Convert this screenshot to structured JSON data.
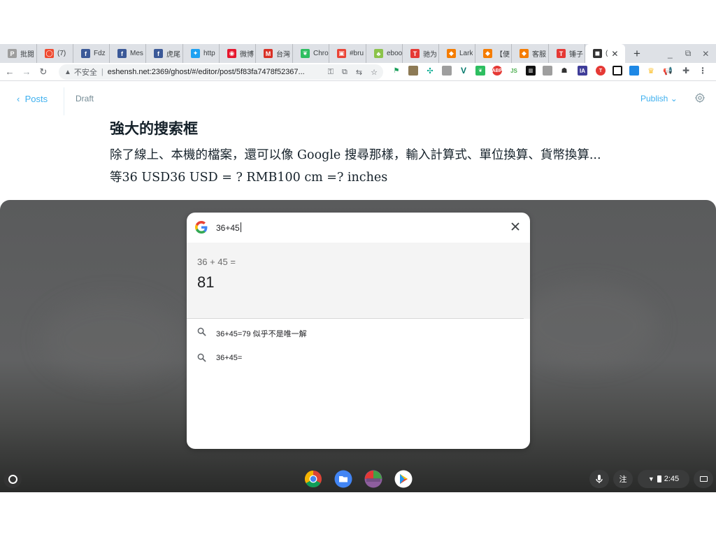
{
  "tabs": [
    {
      "title": "批閱",
      "color": "#9e9e9e",
      "glyph": "P"
    },
    {
      "title": "(7) ",
      "color": "#ef4a30",
      "glyph": "◯"
    },
    {
      "title": "Fdz",
      "color": "#3b5998",
      "glyph": "f"
    },
    {
      "title": "Mes",
      "color": "#3b5998",
      "glyph": "f"
    },
    {
      "title": "虎尾",
      "color": "#3b5998",
      "glyph": "f"
    },
    {
      "title": "http",
      "color": "#1da1f2",
      "glyph": "✦"
    },
    {
      "title": "微博",
      "color": "#e6162d",
      "glyph": "◉"
    },
    {
      "title": "台灣",
      "color": "#d93025",
      "glyph": "M"
    },
    {
      "title": "Chro",
      "color": "#2dbe60",
      "glyph": "❦"
    },
    {
      "title": "#bru",
      "color": "#ea4335",
      "glyph": "▣"
    },
    {
      "title": "eboo",
      "color": "#8bc34a",
      "glyph": "♣"
    },
    {
      "title": "驰为",
      "color": "#e53935",
      "glyph": "T"
    },
    {
      "title": "Lark",
      "color": "#f57c00",
      "glyph": "◆"
    },
    {
      "title": "【便",
      "color": "#f57c00",
      "glyph": "◆"
    },
    {
      "title": "客服",
      "color": "#f57c00",
      "glyph": "◆"
    },
    {
      "title": "锤子",
      "color": "#e53935",
      "glyph": "T"
    },
    {
      "title": "(",
      "color": "#333333",
      "glyph": "◼",
      "active": true
    }
  ],
  "new_tab_label": "+",
  "omnibox": {
    "warning_icon": "warning-triangle-icon",
    "insecure_label": "不安全",
    "url": "eshensh.net:2369/ghost/#/editor/post/5f83fa7478f52367..."
  },
  "editor": {
    "back_label": "Posts",
    "status_label": "Draft",
    "publish_label": "Publish",
    "heading": "強大的搜索框",
    "paragraph": "除了線上、本機的檔案，還可以像 Google 搜尋那樣，輸入計算式、單位換算、貨幣換算...等36 USD36 USD = ? RMB100 cm =? inches"
  },
  "launcher": {
    "query": "36+45",
    "calc_expression": "36 + 45 =",
    "calc_result": "81",
    "results": [
      {
        "text": "36+45=79 似乎不是唯一解"
      },
      {
        "text": "36+45="
      }
    ]
  },
  "shelf": {
    "ime_label": "注",
    "time": "2:45",
    "apps": [
      "chrome-icon",
      "files-icon",
      "version-app-icon",
      "play-store-icon"
    ]
  }
}
